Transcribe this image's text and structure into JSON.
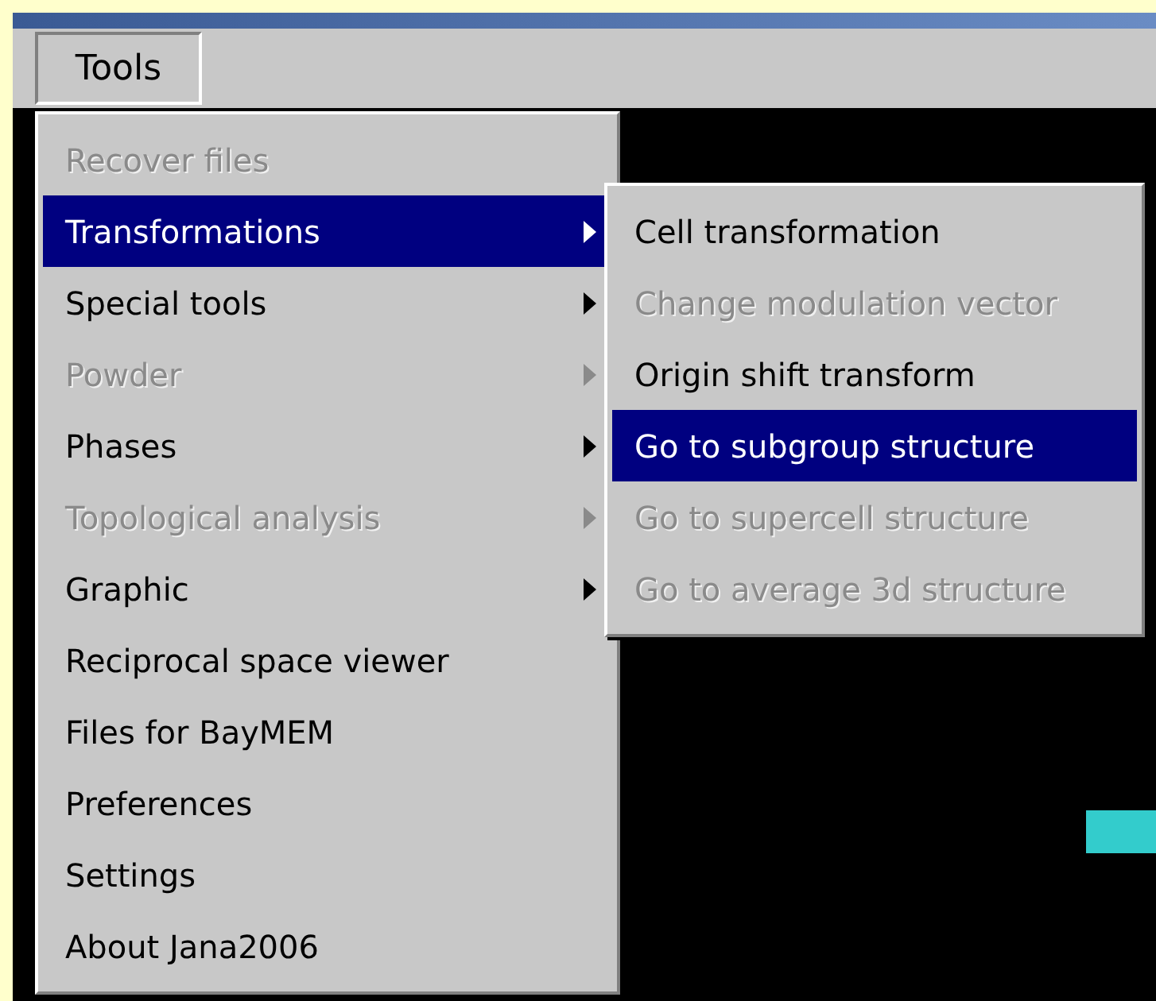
{
  "menu_bar": {
    "items": [
      {
        "label": "Tools",
        "selected": true
      }
    ]
  },
  "tools_menu": {
    "items": [
      {
        "label": "Recover files",
        "disabled": true,
        "selected": false,
        "submenu": false
      },
      {
        "label": "Transformations",
        "disabled": false,
        "selected": true,
        "submenu": true
      },
      {
        "label": "Special tools",
        "disabled": false,
        "selected": false,
        "submenu": true
      },
      {
        "label": "Powder",
        "disabled": true,
        "selected": false,
        "submenu": true
      },
      {
        "label": "Phases",
        "disabled": false,
        "selected": false,
        "submenu": true
      },
      {
        "label": "Topological analysis",
        "disabled": true,
        "selected": false,
        "submenu": true
      },
      {
        "label": "Graphic",
        "disabled": false,
        "selected": false,
        "submenu": true
      },
      {
        "label": "Reciprocal space viewer",
        "disabled": false,
        "selected": false,
        "submenu": false
      },
      {
        "label": "Files for BayMEM",
        "disabled": false,
        "selected": false,
        "submenu": false
      },
      {
        "label": "Preferences",
        "disabled": false,
        "selected": false,
        "submenu": false
      },
      {
        "label": "Settings",
        "disabled": false,
        "selected": false,
        "submenu": false
      },
      {
        "label": "About Jana2006",
        "disabled": false,
        "selected": false,
        "submenu": false
      }
    ]
  },
  "transformations_submenu": {
    "items": [
      {
        "label": "Cell transformation",
        "disabled": false,
        "selected": false,
        "submenu": false
      },
      {
        "label": "Change modulation vector",
        "disabled": true,
        "selected": false,
        "submenu": false
      },
      {
        "label": "Origin shift transform",
        "disabled": false,
        "selected": false,
        "submenu": false
      },
      {
        "label": "Go to subgroup structure",
        "disabled": false,
        "selected": true,
        "submenu": false
      },
      {
        "label": "Go to supercell structure",
        "disabled": true,
        "selected": false,
        "submenu": false
      },
      {
        "label": "Go to average 3d structure",
        "disabled": true,
        "selected": false,
        "submenu": false
      }
    ]
  }
}
